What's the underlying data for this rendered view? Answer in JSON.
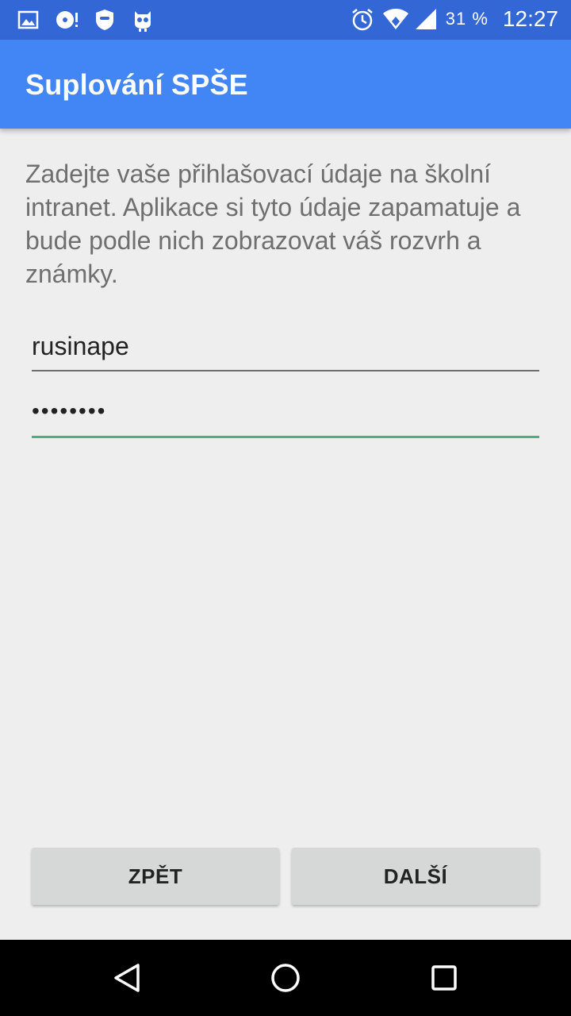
{
  "statusbar": {
    "battery_percent": "31 %",
    "time": "12:27",
    "left_icons": [
      "image-icon",
      "disc-notification-icon",
      "shield-icon",
      "cyanogen-icon"
    ],
    "right_icons": [
      "alarm-icon",
      "wifi-icon",
      "signal-icon"
    ]
  },
  "appbar": {
    "title": "Suplování SPŠE"
  },
  "main": {
    "intro": "Zadejte vaše přihlašovací údaje na školní intranet. Aplikace si tyto údaje zapamatuje a bude podle nich zobrazovat váš rozvrh a známky.",
    "username_value": "rusinape",
    "password_value": "••••••••"
  },
  "buttons": {
    "back_label": "ZPĚT",
    "next_label": "DALŠÍ"
  },
  "navbar": {
    "icons": [
      "back-triangle-icon",
      "home-circle-icon",
      "recents-square-icon"
    ]
  },
  "colors": {
    "statusbar": "#3367d6",
    "appbar": "#4285f4",
    "background": "#eeeeee",
    "accent_underline": "#4caf7d",
    "button": "#d6d7d7"
  }
}
